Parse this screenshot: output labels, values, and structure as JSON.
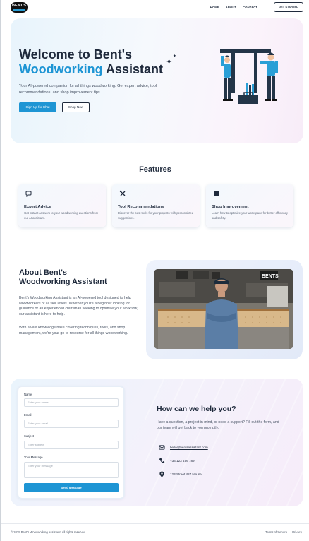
{
  "header": {
    "logo_text": "BENT'S",
    "nav": [
      "HOME",
      "ABOUT",
      "CONTACT"
    ],
    "cta_label": "GET STARTED"
  },
  "hero": {
    "title_line1": "Welcome to Bent's",
    "title_accent": "Woodworking",
    "title_rest": " Assistant",
    "description": "Your AI-powered companion for all things woodworking. Get expert advice, tool recommendations, and shop improvement tips.",
    "signup_label": "Sign Up for Chat",
    "shop_label": "Shop Now"
  },
  "features": {
    "title": "Features",
    "items": [
      {
        "icon": "chat-wrench-icon",
        "title": "Expert Advice",
        "desc": "Get instant answers to your woodworking questions from our AI assistant."
      },
      {
        "icon": "tools-icon",
        "title": "Tool Recommendations",
        "desc": "Discover the best tools for your projects with personalized suggestions."
      },
      {
        "icon": "workbench-icon",
        "title": "Shop Improvement",
        "desc": "Learn how to optimize your workspace for better efficiency and safety."
      }
    ]
  },
  "about": {
    "title_line1": "About Bent's",
    "title_line2": "Woodworking Assistant",
    "p1": "Bent's Woodworking Assistant is an AI-powered tool designed to help woodworkers of all skill levels. Whether you're a beginner looking for guidance or an experienced craftsman seeking to optimize your workflow, our assistant is here to help.",
    "p2": "With a vast knowledge base covering techniques, tools, and shop management, we're your go-to resource for all things woodworking.",
    "photo_sign": "BENTS"
  },
  "contact": {
    "form": {
      "name_label": "Name",
      "name_placeholder": "Enter your name",
      "email_label": "Email",
      "email_placeholder": "Enter your email",
      "subject_label": "Subject",
      "subject_placeholder": "Enter subject",
      "message_label": "Your Message",
      "message_placeholder": "Enter your message",
      "send_label": "Send Message"
    },
    "title": "How can we help you?",
    "description": "Have a question, a project in mind, or need a support? Fill out the form, and our team will get back to you promptly.",
    "email": "hello@bentsassistant.com",
    "phone": "+34 123 456 789",
    "address": "123 Street 487 House"
  },
  "footer": {
    "copyright": "© 2025 Bent's Woodworking Assistant. All rights reserved.",
    "links": [
      "Terms of Service",
      "Privacy"
    ]
  },
  "colors": {
    "accent": "#1e95d4",
    "text": "#1f2a3c"
  }
}
